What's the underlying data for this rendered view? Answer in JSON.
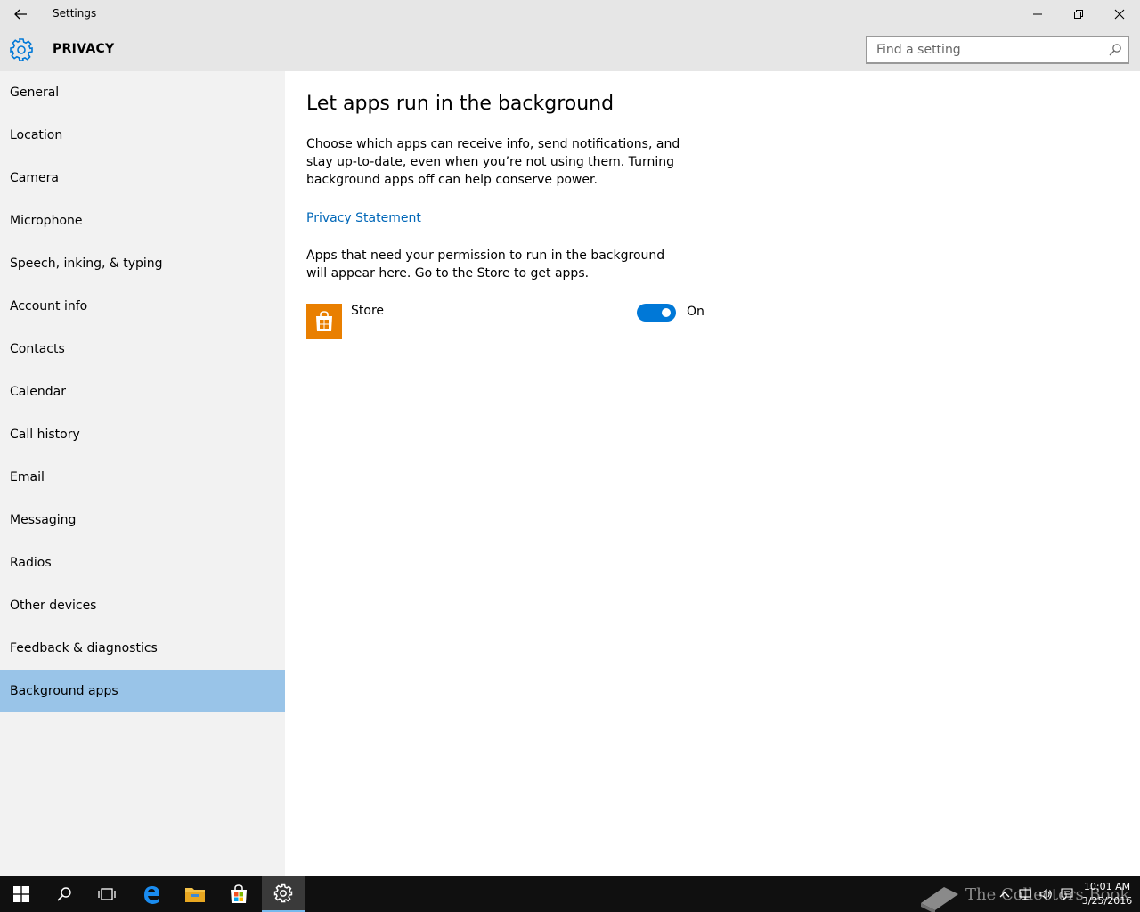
{
  "window": {
    "title": "Settings"
  },
  "header": {
    "section_title": "PRIVACY",
    "search_placeholder": "Find a setting"
  },
  "sidebar": {
    "items": [
      {
        "label": "General"
      },
      {
        "label": "Location"
      },
      {
        "label": "Camera"
      },
      {
        "label": "Microphone"
      },
      {
        "label": "Speech, inking, & typing"
      },
      {
        "label": "Account info"
      },
      {
        "label": "Contacts"
      },
      {
        "label": "Calendar"
      },
      {
        "label": "Call history"
      },
      {
        "label": "Email"
      },
      {
        "label": "Messaging"
      },
      {
        "label": "Radios"
      },
      {
        "label": "Other devices"
      },
      {
        "label": "Feedback & diagnostics"
      },
      {
        "label": "Background apps"
      }
    ],
    "selected_label": "Background apps"
  },
  "content": {
    "title": "Let apps run in the background",
    "description": "Choose which apps can receive info, send notifications, and stay up-to-date, even when you’re not using them. Turning background apps off can help conserve power.",
    "privacy_link": "Privacy Statement",
    "permission_text": "Apps that need your permission to run in the background will appear here. Go to the Store to get apps.",
    "apps": [
      {
        "name": "Store",
        "state": "On",
        "icon": "store-bag-icon"
      }
    ]
  },
  "taskbar": {
    "watermark": "The Collectors Book",
    "clock_time": "10:01 AM",
    "clock_date": "3/25/2016"
  },
  "colors": {
    "accent": "#0078d7",
    "link": "#0067b8",
    "selected_bg": "#99c4e8",
    "store_tile": "#e97f00",
    "taskbar": "#101010"
  }
}
